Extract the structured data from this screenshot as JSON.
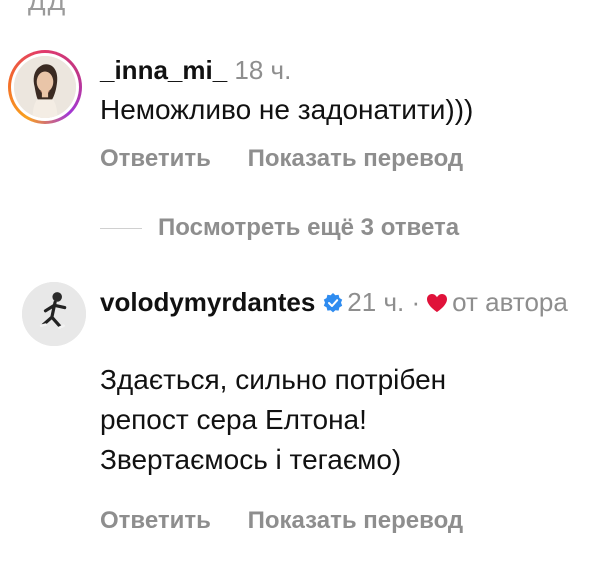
{
  "top_partial": {
    "text": "ДД"
  },
  "comment1": {
    "username": "_inna_mi_",
    "time": "18 ч.",
    "text": "Неможливо не задонатити)))",
    "reply_label": "Ответить",
    "translate_label": "Показать перевод",
    "avatar_icon": "profile-photo-woman-icon",
    "has_story_ring": true
  },
  "more_replies": {
    "label": "Посмотреть ещё 3 ответа"
  },
  "comment2": {
    "username": "volodymyrdantes",
    "verified": true,
    "time": "21 ч.",
    "separator": "·",
    "liked_by_author_label": "от автора",
    "text_line1": "Здається, сильно потрібен",
    "text_line2": "репост сера Елтона!",
    "text_line3": "Звертаємось і тегаємо)",
    "reply_label": "Ответить",
    "translate_label": "Показать перевод",
    "avatar_icon": "profile-photo-man-icon",
    "heart_color": "#e0123a",
    "verified_color": "#2f8cf0"
  },
  "colors": {
    "muted_text": "#8e8e8e",
    "primary_text": "#111111",
    "background": "#ffffff"
  }
}
